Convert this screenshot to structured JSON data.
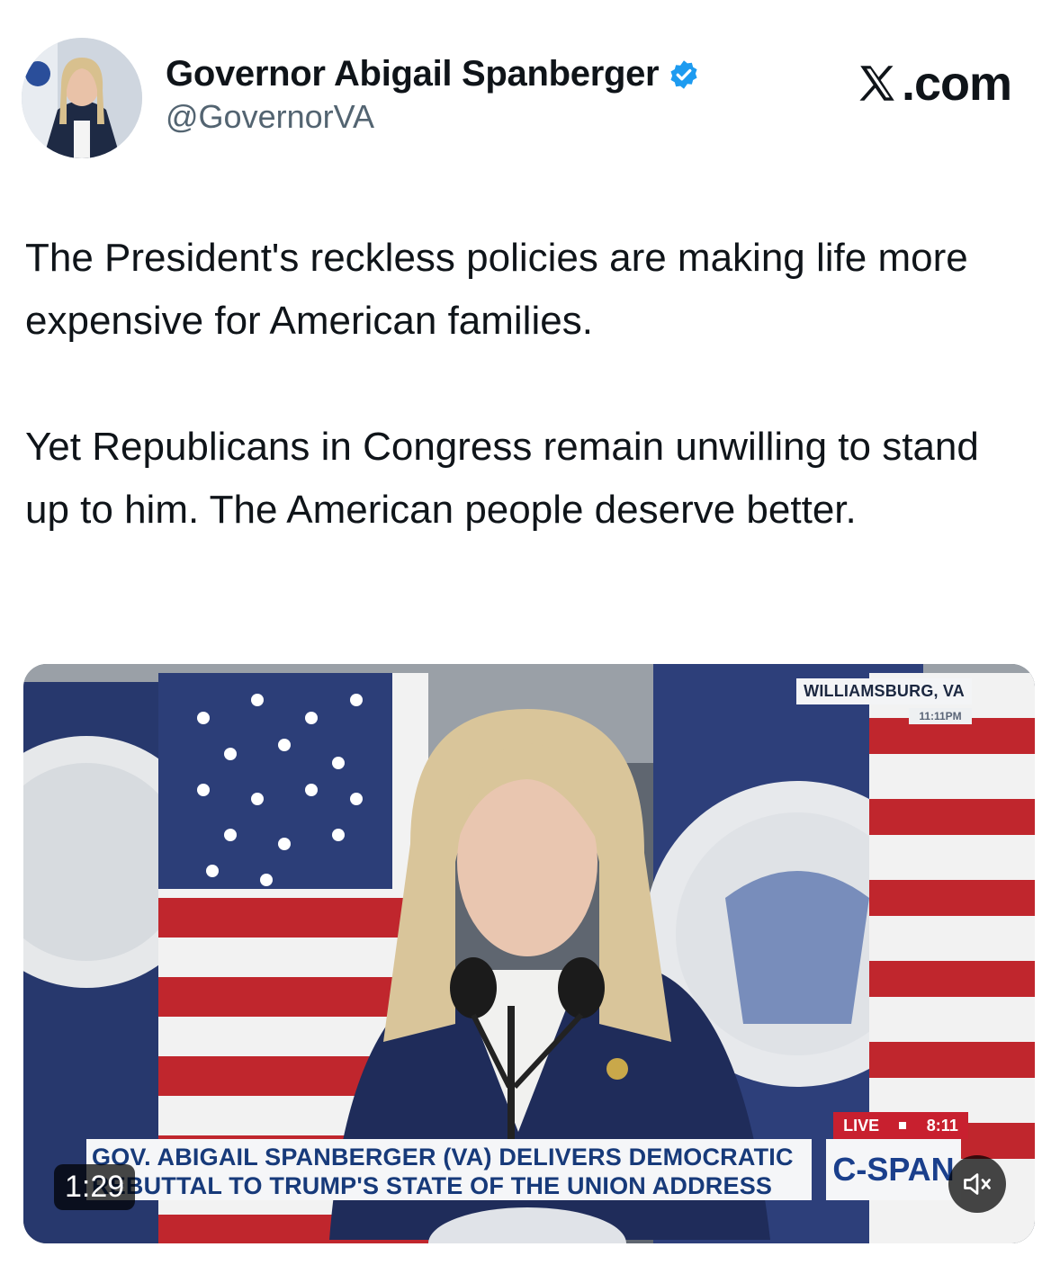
{
  "author": {
    "name": "Governor Abigail Spanberger",
    "handle": "@GovernorVA",
    "verified": true
  },
  "site_label": ".com",
  "post": {
    "paragraphs": [
      "The President's reckless policies are making life more expensive for American families.",
      "Yet Republicans in Congress remain unwilling to stand up to him. The American people deserve better."
    ]
  },
  "video": {
    "location": "WILLIAMSBURG, VA",
    "location_time": "11:11PM",
    "live_label": "LIVE",
    "live_time": "8:11",
    "chyron_line1": "GOV. ABIGAIL SPANBERGER (VA) DELIVERS DEMOCRATIC",
    "chyron_line2": "REBUTTAL TO TRUMP'S STATE OF THE UNION ADDRESS",
    "network": "C-SPAN",
    "duration": "1:29",
    "muted": true
  },
  "colors": {
    "verified_badge": "#1d9bf0",
    "handle_gray": "#536471",
    "chyron_text": "#173a7a",
    "live_red": "#c8202f"
  }
}
